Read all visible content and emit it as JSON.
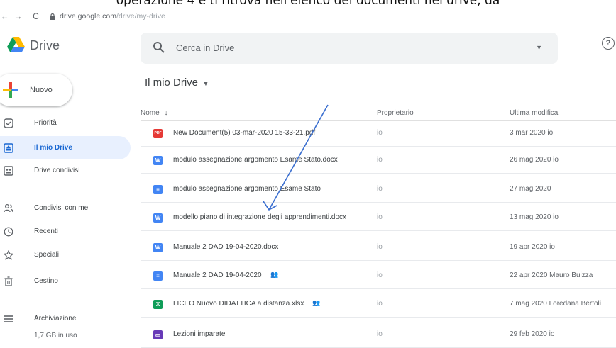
{
  "caption": "operazione 4 e ti ritrova nell'elenco dei documenti nel drive, da",
  "browser": {
    "url_host": "drive.google.com",
    "url_path": "/drive/my-drive"
  },
  "header": {
    "brand": "Drive",
    "search_placeholder": "Cerca in Drive"
  },
  "new_button": "Nuovo",
  "sidebar": {
    "items": [
      {
        "label": "Priorità",
        "icon": "priority-icon"
      },
      {
        "label": "Il mio Drive",
        "icon": "my-drive-icon",
        "active": true
      },
      {
        "label": "Drive condivisi",
        "icon": "shared-drives-icon"
      },
      {
        "label": "Condivisi con me",
        "icon": "shared-with-me-icon"
      },
      {
        "label": "Recenti",
        "icon": "clock-icon"
      },
      {
        "label": "Speciali",
        "icon": "star-icon"
      },
      {
        "label": "Cestino",
        "icon": "trash-icon"
      },
      {
        "label": "Archiviazione",
        "icon": "storage-icon"
      }
    ],
    "storage_used": "1,7 GB in uso"
  },
  "main": {
    "title": "Il mio Drive",
    "columns": {
      "name": "Nome",
      "owner": "Proprietario",
      "modified": "Ultima modifica"
    },
    "files": [
      {
        "name": "New Document(5) 03-mar-2020 15-33-21.pdf",
        "type": "pdf",
        "owner": "io",
        "modified": "3 mar 2020 io"
      },
      {
        "name": "modulo assegnazione argomento Esame Stato.docx",
        "type": "word",
        "owner": "io",
        "modified": "26 mag 2020 io"
      },
      {
        "name": "modulo assegnazione argomento Esame Stato",
        "type": "doc",
        "owner": "io",
        "modified": "27 mag 2020"
      },
      {
        "name": "modello piano di integrazione degli apprendimenti.docx",
        "type": "word",
        "owner": "io",
        "modified": "13 mag 2020 io"
      },
      {
        "name": "Manuale 2 DAD 19-04-2020.docx",
        "type": "word",
        "owner": "io",
        "modified": "19 apr 2020 io"
      },
      {
        "name": "Manuale 2 DAD 19-04-2020",
        "type": "doc",
        "owner": "io",
        "modified": "22 apr 2020 Mauro Buizza",
        "shared": true
      },
      {
        "name": "LICEO Nuovo DIDATTICA a distanza.xlsx",
        "type": "excel",
        "owner": "io",
        "modified": "7 mag 2020 Loredana Bertoli",
        "shared": true
      },
      {
        "name": "Lezioni imparate",
        "type": "slides",
        "owner": "io",
        "modified": "29 feb 2020 io"
      }
    ]
  },
  "colors": {
    "pdf": "#e53935",
    "word": "#4285f4",
    "doc": "#4285f4",
    "excel": "#0f9d58",
    "slides": "#673ab7",
    "arrow": "#3b6fd0",
    "active_bg": "#e8f0fe",
    "active_text": "#1967d2"
  }
}
